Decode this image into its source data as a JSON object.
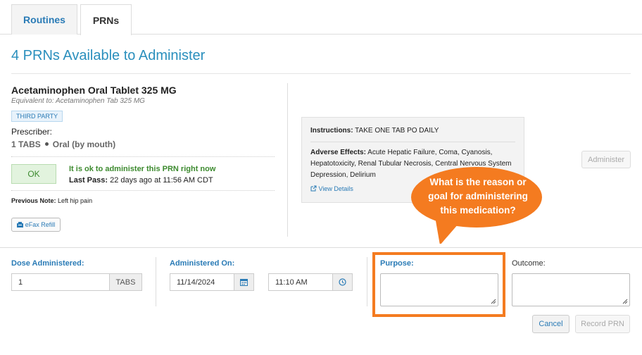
{
  "tabs": [
    {
      "label": "Routines"
    },
    {
      "label": "PRNs"
    }
  ],
  "page_title": "4 PRNs Available to Administer",
  "medication": {
    "name": "Acetaminophen Oral Tablet 325 MG",
    "equivalent": "Equivalent to: Acetaminophen Tab 325 MG",
    "badge": "THIRD PARTY",
    "prescriber_label": "Prescriber:",
    "dose": "1 TABS",
    "route": "Oral (by mouth)",
    "status_box": "OK",
    "status_message": "It is ok to administer this PRN right now",
    "last_pass_label": "Last Pass:",
    "last_pass_value": "22 days ago at 11:56 AM CDT",
    "previous_note_label": "Previous Note:",
    "previous_note_value": "Left hip pain",
    "efax_label": "eFax Refill"
  },
  "info": {
    "instructions_label": "Instructions:",
    "instructions_value": "TAKE ONE TAB PO DAILY",
    "adverse_label": "Adverse Effects:",
    "adverse_value": "Acute Hepatic Failure, Coma, Cyanosis, Hepatotoxicity, Renal Tubular Necrosis, Central Nervous System Depression, Delirium",
    "view_details": "View Details"
  },
  "administer_button": "Administer",
  "callout": {
    "text": "What is the reason or goal for administering this medication?",
    "color": "#f47b20"
  },
  "form": {
    "dose_label": "Dose Administered:",
    "dose_value": "1",
    "dose_unit": "TABS",
    "administered_on_label": "Administered On:",
    "date_value": "11/14/2024",
    "time_value": "11:10 AM",
    "purpose_label": "Purpose:",
    "outcome_label": "Outcome:",
    "purpose_value": "",
    "outcome_value": ""
  },
  "buttons": {
    "cancel": "Cancel",
    "record": "Record PRN"
  }
}
